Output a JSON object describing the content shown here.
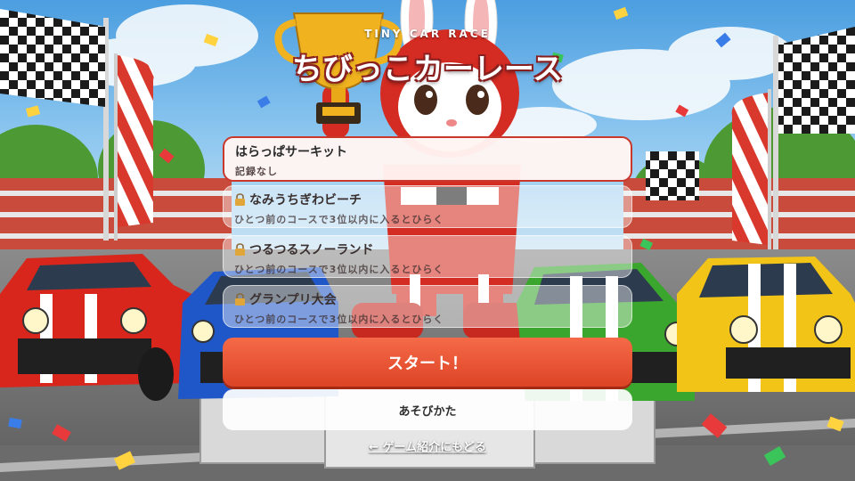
{
  "header": {
    "subtitle": "TINY CAR RACE",
    "title": "ちびっこカーレース"
  },
  "courses": [
    {
      "name": "はらっぱサーキット",
      "desc": "記録なし",
      "locked": false,
      "selected": true
    },
    {
      "name": "なみうちぎわビーチ",
      "desc": "ひとつ前のコースで3位以内に入るとひらく",
      "locked": true,
      "selected": false
    },
    {
      "name": "つるつるスノーランド",
      "desc": "ひとつ前のコースで3位以内に入るとひらく",
      "locked": true,
      "selected": false
    },
    {
      "name": "グランプリ大会",
      "desc": "ひとつ前のコースで3位以内に入るとひらく",
      "locked": true,
      "selected": false
    }
  ],
  "buttons": {
    "start": "スタート！",
    "howto": "あそびかた",
    "back": "← ゲーム紹介にもどる"
  },
  "colors": {
    "accent": "#e0492b",
    "selected_border": "#c9382a",
    "sky": "#5aa7e0",
    "car_red": "#d8261c",
    "car_blue": "#2057c8",
    "car_green": "#3aa62e",
    "car_yellow": "#f2c418"
  },
  "icons": {
    "lock": "lock-icon",
    "trophy": "trophy-icon"
  }
}
